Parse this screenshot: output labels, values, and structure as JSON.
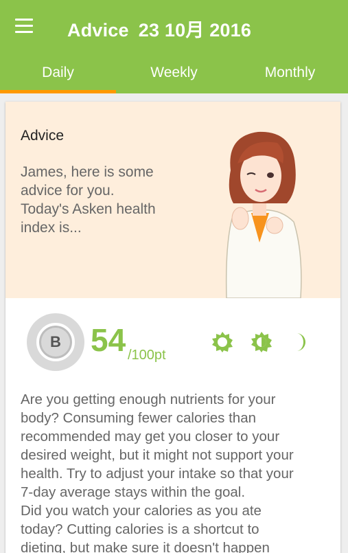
{
  "appbar": {
    "title": "Advice",
    "date": "23 10月 2016",
    "menu_icon": "hamburger-menu-icon",
    "background_color": "#8bc34a",
    "accent_color": "#ff9800"
  },
  "tabs": [
    {
      "label": "Daily",
      "active": true
    },
    {
      "label": "Weekly",
      "active": false
    },
    {
      "label": "Monthly",
      "active": false
    }
  ],
  "advice": {
    "heading": "Advice",
    "lines": [
      "James, here is some",
      "advice for you.",
      "Today's Asken health",
      "index is..."
    ],
    "panel_color": "#feeedc"
  },
  "score": {
    "grade": "B",
    "value": "54",
    "unit": "/100pt",
    "meal_icons": [
      "morning-sun-icon",
      "afternoon-half-sun-icon",
      "night-moon-icon"
    ]
  },
  "body": {
    "lines": [
      "Are you getting enough nutrients for your",
      "body? Consuming fewer calories than",
      "recommended may get you closer to your",
      "desired weight, but it might not support your",
      "health. Try to adjust your intake so that your",
      "7-day average stays within the goal.",
      "Did you watch your calories as you ate",
      "today? Cutting calories is a shortcut to",
      "dieting, but make sure it doesn't happen"
    ]
  }
}
